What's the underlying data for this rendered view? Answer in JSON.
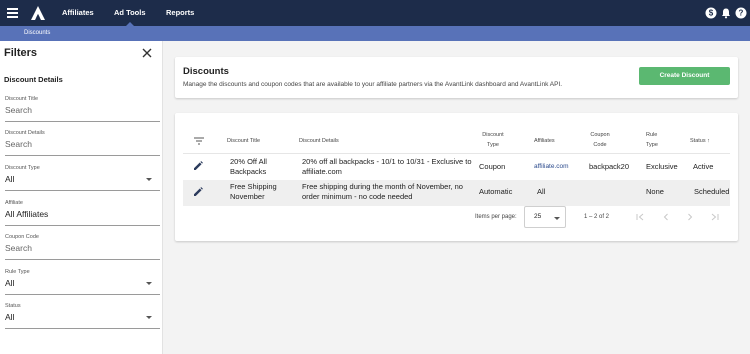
{
  "topnav": {
    "items": [
      {
        "label": "Affiliates"
      },
      {
        "label": "Ad Tools"
      },
      {
        "label": "Reports"
      }
    ],
    "active_item": "Ad Tools",
    "icons": [
      "menu-icon",
      "logo",
      "dollar-icon",
      "bell-icon",
      "help-icon"
    ]
  },
  "subnav": {
    "items": [
      {
        "label": "Discounts"
      }
    ]
  },
  "sidebar": {
    "title": "Filters",
    "section_title": "Discount Details",
    "fields": [
      {
        "label": "Discount Title",
        "value": "Search"
      },
      {
        "label": "Discount Details",
        "value": "Search"
      },
      {
        "label": "Discount Type",
        "value": "All"
      },
      {
        "label": "Affiliate",
        "value": "All Affiliates"
      },
      {
        "label": "Coupon Code",
        "value": "Search"
      },
      {
        "label": "Rule Type",
        "value": "All"
      },
      {
        "label": "Status",
        "value": "All"
      }
    ]
  },
  "header_card": {
    "title": "Discounts",
    "description": "Manage the discounts and coupon codes that are available to your affiliate partners via the AvantLink dashboard and AvantLink API.",
    "create_button": "Create Discount"
  },
  "table": {
    "columns": [
      {
        "label": "Discount Title"
      },
      {
        "label": "Discount Details"
      },
      {
        "label": "Discount Type"
      },
      {
        "label": "Affiliates"
      },
      {
        "label": "Coupon Code"
      },
      {
        "label": "Rule Type"
      },
      {
        "label": "Status ↑"
      }
    ],
    "rows": [
      {
        "title": "20% Off All Backpacks",
        "details": "20% off all backpacks - 10/1 to 10/31 - Exclusive to affiliate.com",
        "type": "Coupon",
        "affiliates": "affiliate.com",
        "coupon_code": "backpack20",
        "rule_type": "Exclusive",
        "status": "Active"
      },
      {
        "title": "Free Shipping November",
        "details": "Free shipping during the month of November, no order minimum - no code needed",
        "type": "Automatic",
        "affiliates": "All",
        "coupon_code": "",
        "rule_type": "None",
        "status": "Scheduled"
      }
    ],
    "pagination": {
      "items_per_page_label": "Items per page:",
      "items_per_page": "25",
      "range": "1 – 2 of 2"
    }
  },
  "colors": {
    "topnav_bg": "#1d2c4a",
    "subnav_bg": "#5872b8",
    "primary_button": "#5bb871",
    "link": "#2b4a8c"
  }
}
